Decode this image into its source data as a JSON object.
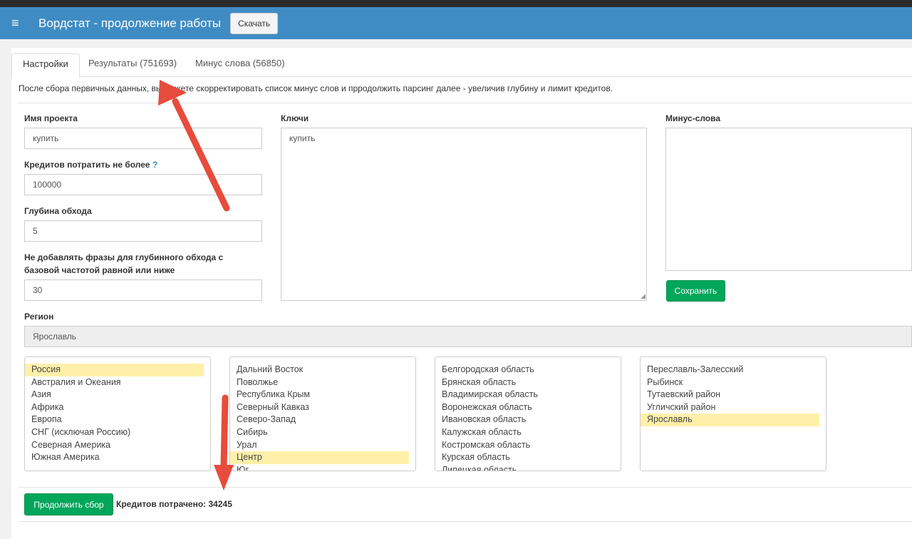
{
  "app": {
    "title": "Вордстат - продолжение работы",
    "download_label": "Скачать",
    "menu_icon": "≡"
  },
  "tabs": [
    {
      "label": "Настройки"
    },
    {
      "label": "Результаты (751693)"
    },
    {
      "label": "Минус слова (56850)"
    }
  ],
  "info_text": "После сбора первичных данных, вы можете скорректировать список минус слов и пpродолжить парсинг далее - увеличив глубину и лимит кредитов.",
  "form": {
    "project_name": {
      "label": "Имя проекта",
      "value": "купить"
    },
    "credits_limit": {
      "label": "Кредитов потратить не более",
      "help": "?",
      "value": "100000"
    },
    "depth": {
      "label": "Глубина обхода",
      "value": "5"
    },
    "min_freq": {
      "label_line1": "Не добавлять фразы для глубинного обхода с",
      "label_line2": "базовой частотой равной или ниже",
      "value": "30"
    },
    "keys": {
      "label": "Ключи",
      "value": "купить"
    },
    "minus_words": {
      "label": "Минус-слова",
      "value": "",
      "save_label": "Сохранить"
    },
    "region": {
      "label": "Регион",
      "selected": "Ярославль",
      "lists": [
        {
          "options": [
            "Россия",
            "Австралия и Океания",
            "Азия",
            "Африка",
            "Европа",
            "СНГ (исключая Россию)",
            "Северная Америка",
            "Южная Америка"
          ],
          "selected_index": 0
        },
        {
          "options": [
            "Дальний Восток",
            "Поволжье",
            "Республика Крым",
            "Северный Кавказ",
            "Северо-Запад",
            "Сибирь",
            "Урал",
            "Центр",
            "Юг"
          ],
          "selected_index": 7
        },
        {
          "options": [
            "Белгородская область",
            "Брянская область",
            "Владимирская область",
            "Воронежская область",
            "Ивановская область",
            "Калужская область",
            "Костромская область",
            "Курская область",
            "Липецкая область"
          ],
          "selected_index": -1
        },
        {
          "options": [
            "Переславль-Залесский",
            "Рыбинск",
            "Тутаевский район",
            "Угличский район",
            "Ярославль"
          ],
          "selected_index": 4
        }
      ]
    }
  },
  "footer": {
    "continue_label": "Продолжить сбор",
    "spent_text": "Кредитов потрачено: 34245"
  },
  "colors": {
    "navbar": "#3f8cc4",
    "primary_green": "#00a65a",
    "selected_option": "#fff0a9",
    "arrow": "#e74c3c"
  }
}
